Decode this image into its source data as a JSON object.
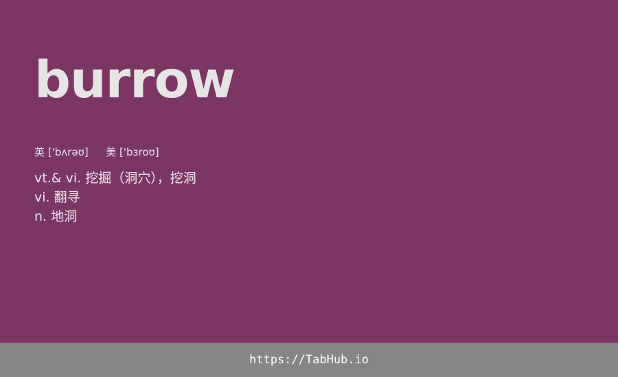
{
  "word": "burrow",
  "phonetics": {
    "uk_label": "英",
    "uk": "['bʌrəʊ]",
    "us_label": "美",
    "us": "['bɜroʊ]"
  },
  "definitions": [
    "vt.& vi. 挖掘（洞穴），挖洞",
    "vi. 翻寻",
    "n. 地洞"
  ],
  "footer": {
    "link": "https://TabHub.io"
  },
  "colors": {
    "card_background": "#7b3664",
    "footer_background": "#868686",
    "text": "#e6e4e6"
  }
}
